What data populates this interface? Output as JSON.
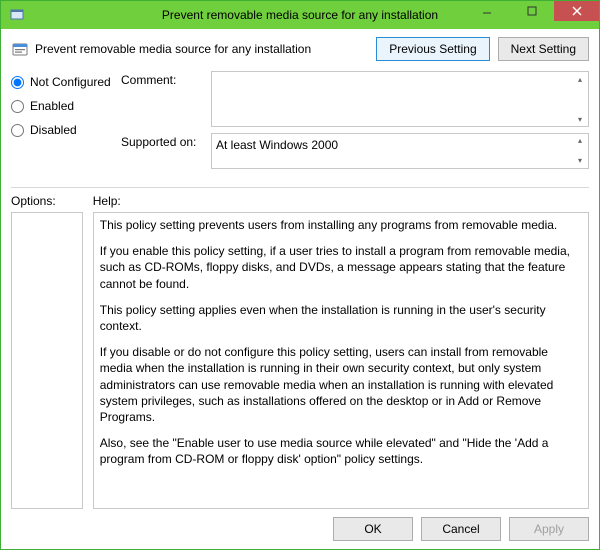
{
  "window": {
    "title": "Prevent removable media source for any installation"
  },
  "header": {
    "policy_title": "Prevent removable media source for any installation",
    "previous_label": "Previous Setting",
    "next_label": "Next Setting"
  },
  "radios": {
    "not_configured": "Not Configured",
    "enabled": "Enabled",
    "disabled": "Disabled",
    "selected": "not_configured"
  },
  "fields": {
    "comment_label": "Comment:",
    "comment_value": "",
    "supported_label": "Supported on:",
    "supported_value": "At least Windows 2000"
  },
  "panes": {
    "options_label": "Options:",
    "help_label": "Help:"
  },
  "help": {
    "p1": "This policy setting prevents users from installing any programs from removable media.",
    "p2": "If you enable this policy setting, if a user tries to install a program from removable media, such as CD-ROMs, floppy disks, and DVDs, a message appears stating that the feature cannot be found.",
    "p3": "This policy setting applies even when the installation is running in the user's security context.",
    "p4": "If you disable or do not configure this policy setting, users can install from removable media when the installation is running in their own security context, but only system administrators can use removable media when an installation is running with elevated system privileges, such as installations offered on the desktop or in Add or Remove Programs.",
    "p5": "Also, see the \"Enable user to use media source while elevated\" and \"Hide the 'Add a program from CD-ROM or floppy disk' option\" policy settings."
  },
  "footer": {
    "ok": "OK",
    "cancel": "Cancel",
    "apply": "Apply"
  }
}
